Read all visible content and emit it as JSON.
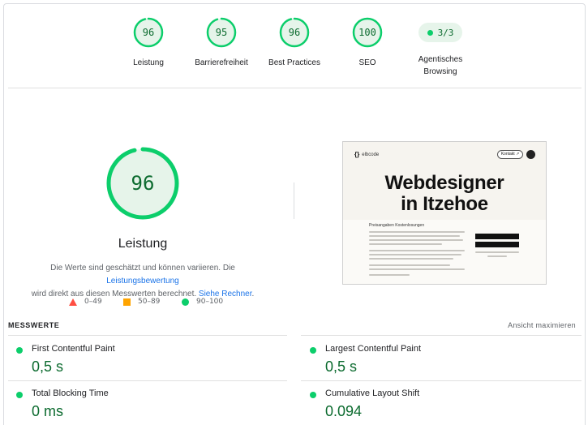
{
  "categories": [
    {
      "score": "96",
      "label": "Leistung",
      "fraction": 0.96
    },
    {
      "score": "95",
      "label": "Barrierefreiheit",
      "fraction": 0.95
    },
    {
      "score": "96",
      "label": "Best Practices",
      "fraction": 0.96
    },
    {
      "score": "100",
      "label": "SEO",
      "fraction": 1.0
    },
    {
      "score": "3/3",
      "label_line1": "Agentisches",
      "label_line2": "Browsing"
    }
  ],
  "main": {
    "score": "96",
    "fraction": 0.96,
    "title": "Leistung",
    "desc_1": "Die Werte sind geschätzt und können variieren. Die ",
    "desc_link_1": "Leistungsbewertung",
    "desc_2": "wird direkt aus diesen Messwerten berechnet. ",
    "desc_link_2": "Siehe Rechner",
    "desc_3": "."
  },
  "legend": {
    "fail": "0–49",
    "average": "50–89",
    "pass": "90–100"
  },
  "screenshot": {
    "logo": "elbcode",
    "contact_button": "Kontakt ↗",
    "hero_line1": "Webdesigner",
    "hero_line2": "in Itzehoe",
    "section_head": "Preisangaben Kostenlosungen"
  },
  "metrics": {
    "header": "MESSWERTE",
    "toggle": "Ansicht maximieren",
    "items": [
      {
        "name": "First Contentful Paint",
        "value": "0,5 s"
      },
      {
        "name": "Largest Contentful Paint",
        "value": "0,5 s"
      },
      {
        "name": "Total Blocking Time",
        "value": "0 ms"
      },
      {
        "name": "Cumulative Layout Shift",
        "value": "0.094"
      }
    ]
  },
  "colors": {
    "pass": "#0cce6b",
    "pass_text": "#0c6b2f",
    "pass_bg": "#e6f4ea",
    "average": "#ffa400",
    "fail": "#ff4e42",
    "link": "#1a73e8"
  }
}
